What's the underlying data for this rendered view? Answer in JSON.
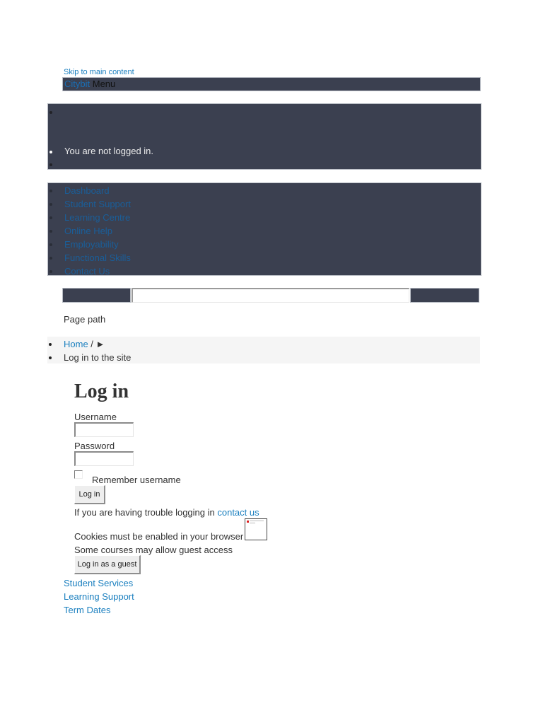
{
  "skip_link": "Skip to main content",
  "navbar": {
    "brand": "Citybit",
    "menu_label": "Menu"
  },
  "user_panel": {
    "login_status": "You are not logged in."
  },
  "custom_menu": {
    "items": [
      {
        "label": "Dashboard"
      },
      {
        "label": "Student Support"
      },
      {
        "label": "Learning Centre"
      },
      {
        "label": "Online Help"
      },
      {
        "label": "Employability"
      },
      {
        "label": "Functional Skills"
      },
      {
        "label": "Contact Us"
      }
    ]
  },
  "search": {
    "value": "",
    "placeholder": ""
  },
  "breadcrumb": {
    "label": "Page path",
    "home": "Home",
    "separator": " / ►",
    "current": "Log in to the site"
  },
  "login": {
    "heading": "Log in",
    "username_label": "Username",
    "username_value": "",
    "password_label": "Password",
    "password_value": "",
    "remember_label": "Remember username",
    "remember_checked": false,
    "login_button": "Log in",
    "help_text": "If you are having trouble logging in ",
    "help_link": "contact us",
    "cookies_text": "Cookies must be enabled in your browser",
    "guest_text": "Some courses may allow guest access",
    "guest_button": "Log in as a guest"
  },
  "footer": {
    "links": [
      {
        "label": "Student Services"
      },
      {
        "label": "Learning Support"
      },
      {
        "label": "Term Dates"
      }
    ]
  },
  "colors": {
    "dark_bar": "#3b4050",
    "link": "#1a7fbf",
    "breadcrumb_bg": "#f5f5f5"
  }
}
